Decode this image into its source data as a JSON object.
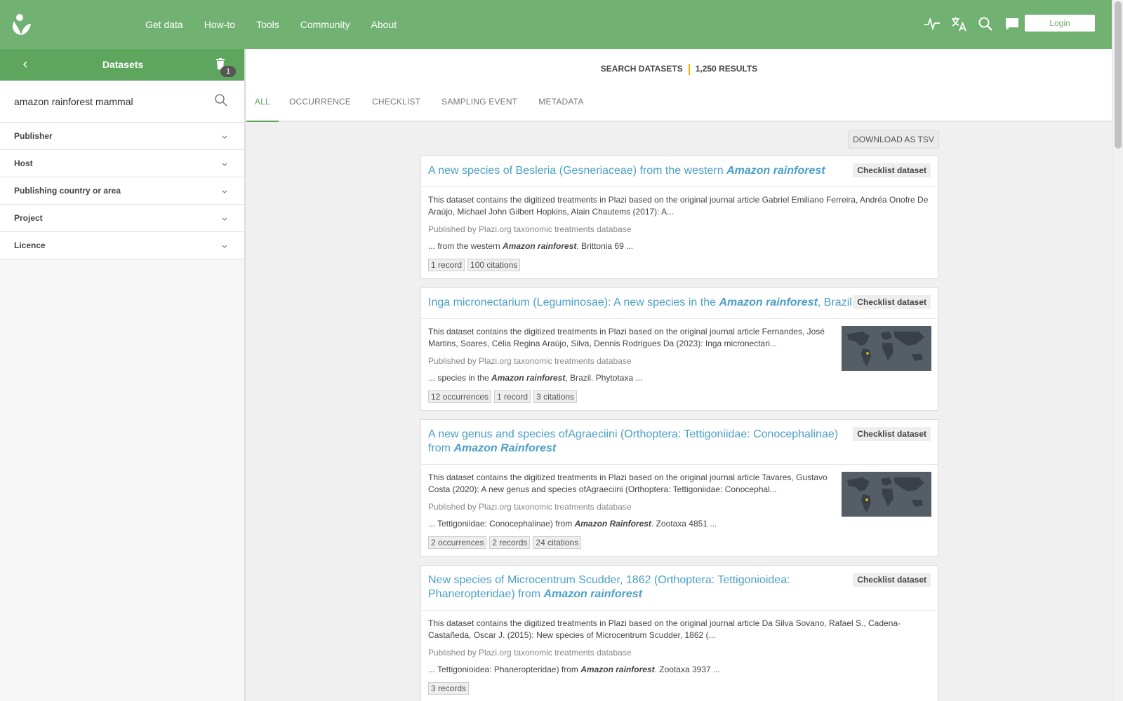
{
  "nav": {
    "items": [
      "Get data",
      "How-to",
      "Tools",
      "Community",
      "About"
    ],
    "login_label": "Login",
    "icons": [
      "pulse-icon",
      "translate-icon",
      "search-icon",
      "chat-icon"
    ]
  },
  "sidebar": {
    "title": "Datasets",
    "badge_count": "1",
    "search_value": "amazon rainforest mammal",
    "facets": [
      "Publisher",
      "Host",
      "Publishing country or area",
      "Project",
      "Licence"
    ]
  },
  "results_header": {
    "left": "SEARCH DATASETS",
    "right": "1,250 RESULTS"
  },
  "tabs": [
    "ALL",
    "OCCURRENCE",
    "CHECKLIST",
    "SAMPLING EVENT",
    "METADATA"
  ],
  "download_label": "DOWNLOAD AS TSV",
  "results": [
    {
      "title_pre": "A new species of Besleria (Gesneriaceae) from the western ",
      "title_em": "Amazon rainforest",
      "title_post": "",
      "tag": "Checklist dataset",
      "desc": "This dataset contains the digitized treatments in Plazi based on the original journal article Gabriel Emiliano Ferreira, Andréa Onofre De Araújo, Michael John Gilbert Hopkins, Alain Chautems (2017): A...",
      "publisher": "Published by Plazi.org taxonomic treatments database",
      "snippet_pre": "... from the western ",
      "snippet_em": "Amazon rainforest",
      "snippet_post": ". Brittonia 69 ...",
      "chips": [
        "1 record",
        "100 citations"
      ],
      "has_map": false
    },
    {
      "title_pre": "Inga micronectarium (Leguminosae): A new species in the ",
      "title_em": "Amazon rainforest",
      "title_post": ", Brazil",
      "tag": "Checklist dataset",
      "desc": "This dataset contains the digitized treatments in Plazi based on the original journal article Fernandes, José Martins, Soares, Célia Regina Araújo, Silva, Dennis Rodrigues Da (2023): Inga micronectari...",
      "publisher": "Published by Plazi.org taxonomic treatments database",
      "snippet_pre": "... species in the ",
      "snippet_em": "Amazon rainforest",
      "snippet_post": ", Brazil. Phytotaxa ...",
      "chips": [
        "12 occurrences",
        "1 record",
        "3 citations"
      ],
      "has_map": true
    },
    {
      "title_pre": "A new genus and species ofAgraeciini (Orthoptera: Tettigoniidae: Conocephalinae) from ",
      "title_em": "Amazon Rainforest",
      "title_post": "",
      "tag": "Checklist dataset",
      "desc": "This dataset contains the digitized treatments in Plazi based on the original journal article Tavares, Gustavo Costa (2020): A new genus and species ofAgraeciini (Orthoptera: Tettigoniidae: Conocephal...",
      "publisher": "Published by Plazi.org taxonomic treatments database",
      "snippet_pre": "... Tettigoniidae: Conocephalinae) from ",
      "snippet_em": "Amazon Rainforest",
      "snippet_post": ". Zootaxa 4851 ...",
      "chips": [
        "2 occurrences",
        "2 records",
        "24 citations"
      ],
      "has_map": true
    },
    {
      "title_pre": "New species of Microcentrum Scudder, 1862 (Orthoptera: Tettigonioidea: Phaneropteridae) from ",
      "title_em": "Amazon rainforest",
      "title_post": "",
      "tag": "Checklist dataset",
      "desc": "This dataset contains the digitized treatments in Plazi based on the original journal article Da Silva Sovano, Rafael S., Cadena-Castañeda, Oscar J. (2015): New species of Microcentrum Scudder, 1862 (...",
      "publisher": "Published by Plazi.org taxonomic treatments database",
      "snippet_pre": "... Tettigonioidea: Phaneropteridae) from ",
      "snippet_em": "Amazon rainforest",
      "snippet_post": ". Zootaxa 3937 ...",
      "chips": [
        "3 records"
      ],
      "has_map": false
    }
  ]
}
